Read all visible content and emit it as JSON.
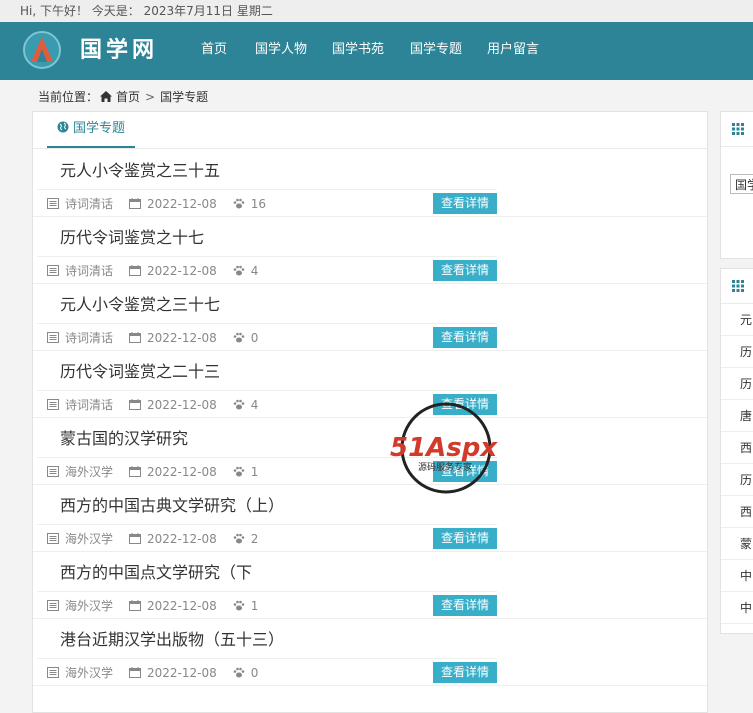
{
  "topbar": {
    "greeting": "Hi, 下午好！ 今天是： 2023年7月11日 星期二"
  },
  "header": {
    "logo_text": "国学网",
    "nav": [
      "首页",
      "国学人物",
      "国学书苑",
      "国学专题",
      "用户留言"
    ]
  },
  "breadcrumb": {
    "prefix": "当前位置：",
    "home": "首页",
    "sep": ">",
    "current": "国学专题"
  },
  "panel": {
    "tab_label": "国学专题",
    "detail_label": "查看详情",
    "articles": [
      {
        "title": "元人小令鉴赏之三十五",
        "category": "诗词清话",
        "date": "2022-12-08",
        "views": "16"
      },
      {
        "title": "历代令词鉴赏之十七",
        "category": "诗词清话",
        "date": "2022-12-08",
        "views": "4"
      },
      {
        "title": "元人小令鉴赏之三十七",
        "category": "诗词清话",
        "date": "2022-12-08",
        "views": "0"
      },
      {
        "title": "历代令词鉴赏之二十三",
        "category": "诗词清话",
        "date": "2022-12-08",
        "views": "4"
      },
      {
        "title": "蒙古国的汉学研究",
        "category": "海外汉学",
        "date": "2022-12-08",
        "views": "1"
      },
      {
        "title": "西方的中国古典文学研究（上）",
        "category": "海外汉学",
        "date": "2022-12-08",
        "views": "2"
      },
      {
        "title": "西方的中国点文学研究（下",
        "category": "海外汉学",
        "date": "2022-12-08",
        "views": "1"
      },
      {
        "title": "港台近期汉学出版物（五十三）",
        "category": "海外汉学",
        "date": "2022-12-08",
        "views": "0"
      }
    ]
  },
  "sidebar": {
    "search_value": "国学",
    "list": [
      "元",
      "历",
      "历",
      "唐",
      "西",
      "历",
      "西",
      "蒙",
      "中",
      "中"
    ]
  },
  "watermark": {
    "brand": "51Aspx",
    "tagline": "源码服务专家"
  },
  "colors": {
    "header_bg": "#2c8496",
    "button_bg": "#39aec9",
    "accent": "#2c8496"
  }
}
